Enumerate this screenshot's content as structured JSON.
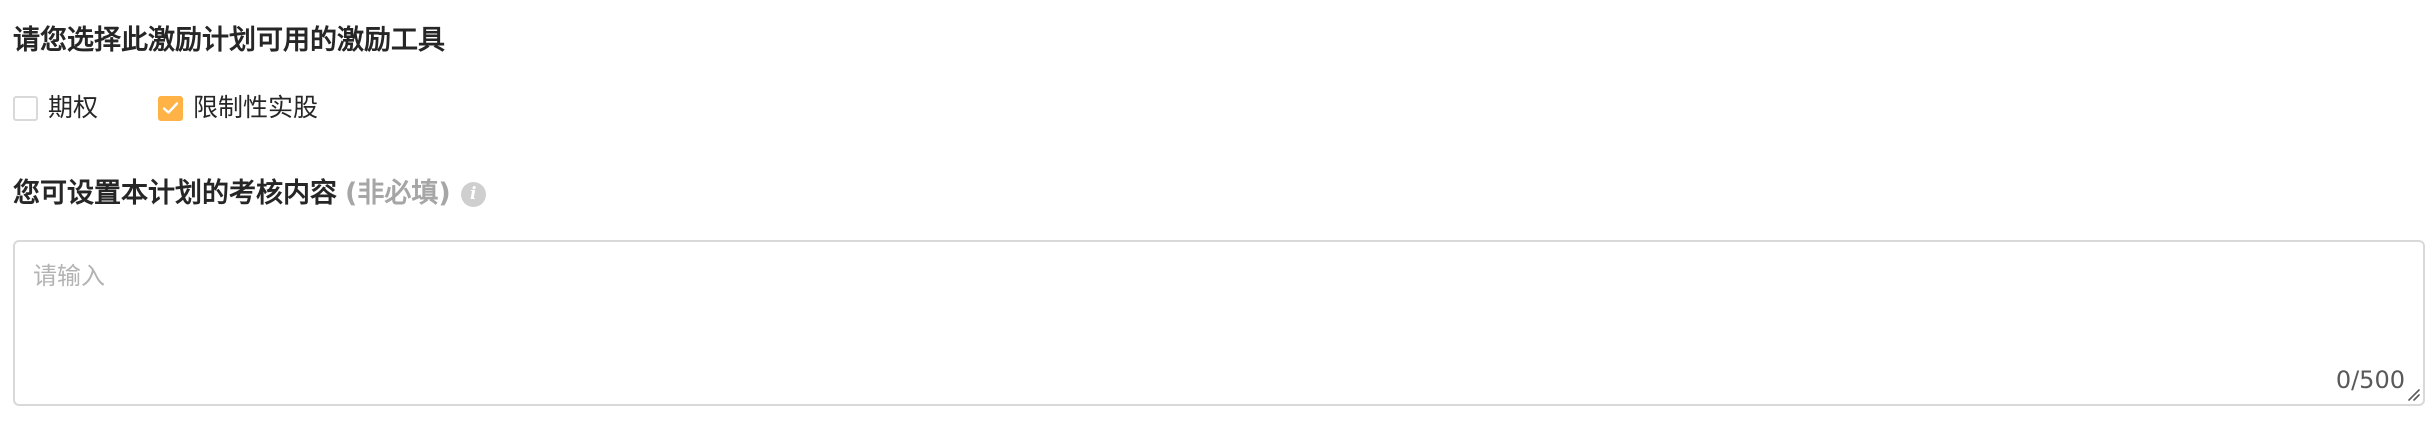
{
  "section1": {
    "title": "请您选择此激励计划可用的激励工具",
    "options": [
      {
        "label": "期权",
        "checked": false
      },
      {
        "label": "限制性实股",
        "checked": true
      }
    ]
  },
  "section2": {
    "title": "您可设置本计划的考核内容",
    "optional_tag": "(非必填)",
    "info_icon": "info-icon",
    "textarea": {
      "placeholder": "请输入",
      "value": "",
      "counter": "0/500"
    }
  },
  "colors": {
    "accent": "#ffb347",
    "border": "#d9d9d9",
    "muted_text": "#a6a6a6",
    "text": "#262626"
  }
}
